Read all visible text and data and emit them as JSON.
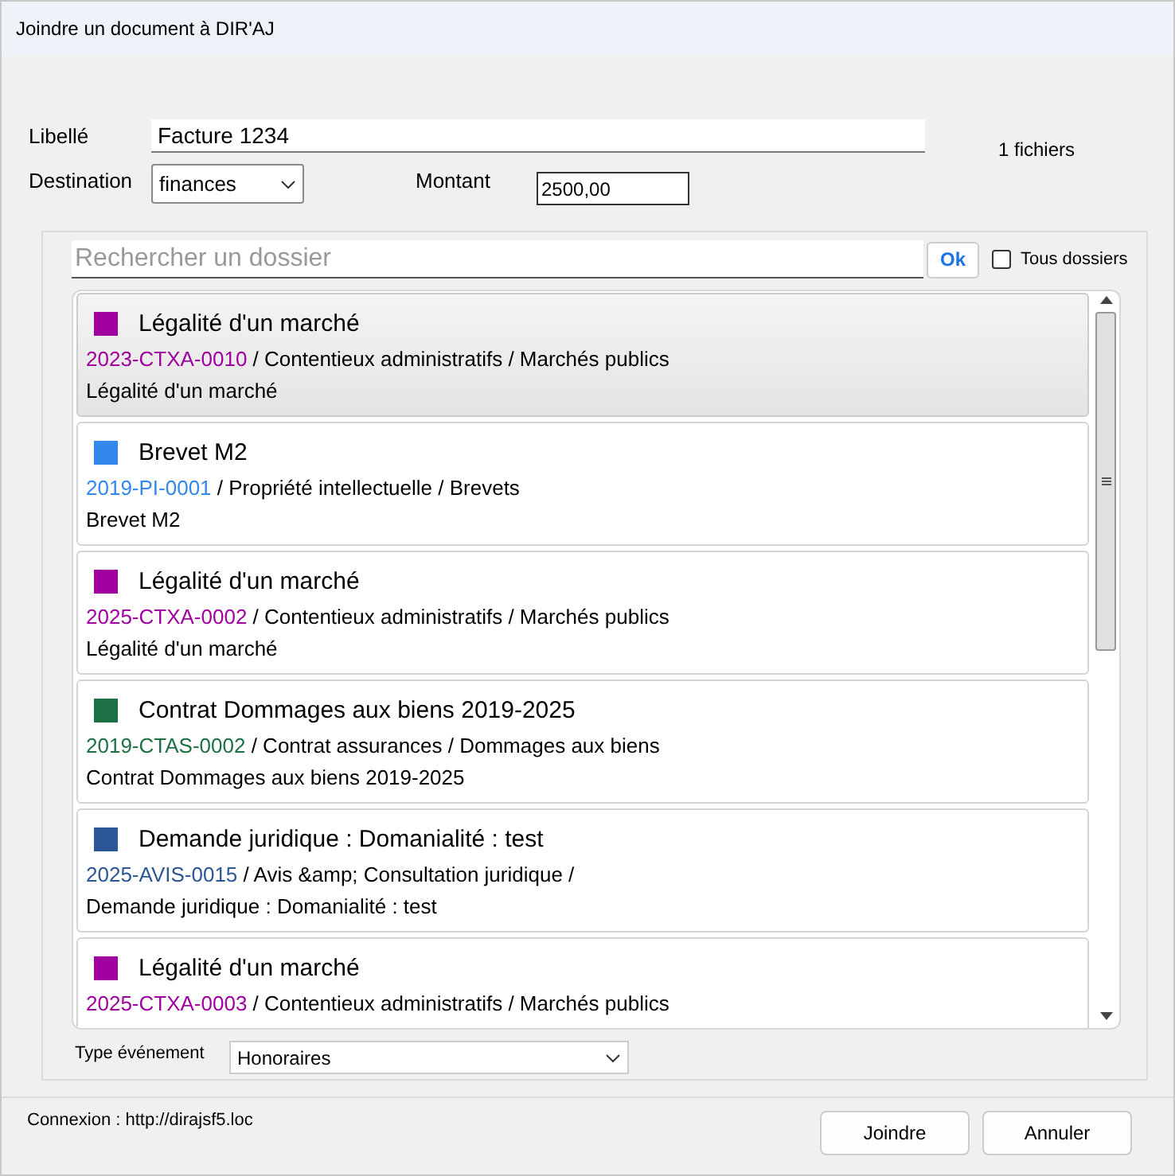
{
  "window": {
    "title": "Joindre un document à DIR'AJ"
  },
  "form": {
    "libelle_label": "Libellé",
    "libelle_value": "Facture 1234",
    "file_count": "1 fichiers",
    "destination_label": "Destination",
    "destination_value": "finances",
    "montant_label": "Montant",
    "montant_value": "2500,00"
  },
  "search": {
    "placeholder": "Rechercher un dossier",
    "button": "Ok",
    "all_folders": {
      "label": "Tous dossiers",
      "checked": false
    }
  },
  "dossiers": [
    {
      "title": "Légalité d'un marché",
      "code": "2023-CTXA-0010",
      "path": " / Contentieux administratifs / Marchés publics",
      "description": "Légalité d'un marché",
      "color": "#a000a0",
      "selected": true
    },
    {
      "title": "Brevet M2",
      "code": "2019-PI-0001",
      "path": " / Propriété intellectuelle / Brevets",
      "description": "Brevet M2",
      "color": "#3388ee",
      "selected": false
    },
    {
      "title": "Légalité d'un marché",
      "code": "2025-CTXA-0002",
      "path": " / Contentieux administratifs / Marchés publics",
      "description": "Légalité d'un marché",
      "color": "#a000a0",
      "selected": false
    },
    {
      "title": "Contrat Dommages aux biens 2019-2025",
      "code": "2019-CTAS-0002",
      "path": " / Contrat assurances / Dommages aux biens",
      "description": "Contrat Dommages aux biens 2019-2025",
      "color": "#1e7145",
      "selected": false
    },
    {
      "title": "Demande juridique : Domanialité : test",
      "code": "2025-AVIS-0015",
      "path": " / Avis &amp; Consultation juridique /",
      "description": "Demande juridique : Domanialité : test",
      "color": "#2b5797",
      "selected": false
    },
    {
      "title": "Légalité d'un marché",
      "code": "2025-CTXA-0003",
      "path": " / Contentieux administratifs / Marchés publics",
      "color": "#a000a0",
      "selected": false
    }
  ],
  "event": {
    "label": "Type événement",
    "value": "Honoraires"
  },
  "footer": {
    "connection": "Connexion : http://dirajsf5.loc",
    "buttons": [
      "Joindre",
      "Annuler"
    ]
  }
}
